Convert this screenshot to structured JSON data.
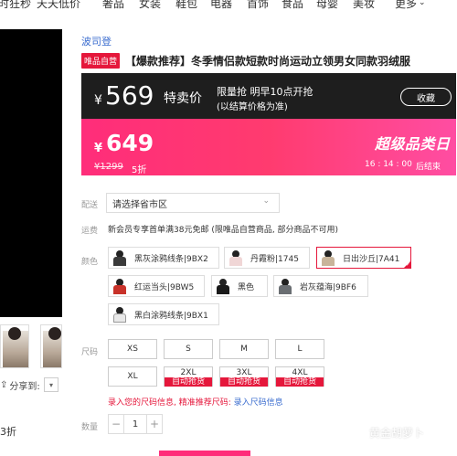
{
  "top_nav": {
    "items": [
      "时狂秒",
      "天天低价",
      "奢品",
      "女装",
      "鞋包",
      "电器",
      "首饰",
      "食品",
      "母婴",
      "美妆",
      "更多"
    ],
    "more_icon": "chevron-down-icon"
  },
  "gallery": {
    "share_label": "分享到:",
    "share_icon": "share-icon",
    "sold_text": "3折"
  },
  "product": {
    "brand": "波司登",
    "badge": "唯品自营",
    "title": "【爆款推荐】冬季情侣款短款时尚运动立领男女同款羽绒服"
  },
  "promo_dark": {
    "yen": "¥",
    "price": "569",
    "tag": "特卖价",
    "line1": "限量抢 明早10点开抢",
    "line2": "(以结算价格为准)",
    "button": "收藏"
  },
  "promo_pink": {
    "yen": "¥",
    "price": "649",
    "original": "¥1299",
    "discount": "5折",
    "banner": "超级品类日",
    "countdown": "16 : 14 : 00",
    "ends": "后结束"
  },
  "delivery": {
    "label": "配送",
    "placeholder": "请选择省市区"
  },
  "shipping": {
    "label": "运费",
    "text": "新会员专享首单满38元免邮 (限唯品自营商品, 部分商品不可用)"
  },
  "colors": {
    "label": "颜色",
    "options": [
      {
        "name": "黑灰涂鸦线条|9BX2",
        "swatch": "#3a3a3a"
      },
      {
        "name": "丹霞粉|1745",
        "swatch": "#f0d6d6"
      },
      {
        "name": "日出沙丘|7A41",
        "swatch": "#c8b49a"
      },
      {
        "name": "红运当头|9BW5",
        "swatch": "#c8322a"
      },
      {
        "name": "黑色",
        "swatch": "#1a1a1a"
      },
      {
        "name": "岩灰蕴海|9BF6",
        "swatch": "#6a6e72"
      },
      {
        "name": "黑白涂鸦线条|9BX1",
        "swatch": "#e8e8e8"
      }
    ],
    "selected_index": 2
  },
  "sizes": {
    "label": "尺码",
    "options": [
      "XS",
      "S",
      "M",
      "L",
      "XL",
      "2XL",
      "3XL",
      "4XL"
    ],
    "auto_label": "自动抢货",
    "link_prefix": "录入您的尺码信息, 精准推荐尺码:",
    "link_action": "录入尺码信息"
  },
  "quantity": {
    "label": "数量",
    "value": "1",
    "minus": "−",
    "plus": "+"
  },
  "watermark": "黄金胡萝卜",
  "colors_theme": {
    "accent": "#e5173b",
    "pink": "#ff2d7a",
    "link": "#3a6ccf",
    "dark_banner": "#1e1e1e"
  }
}
